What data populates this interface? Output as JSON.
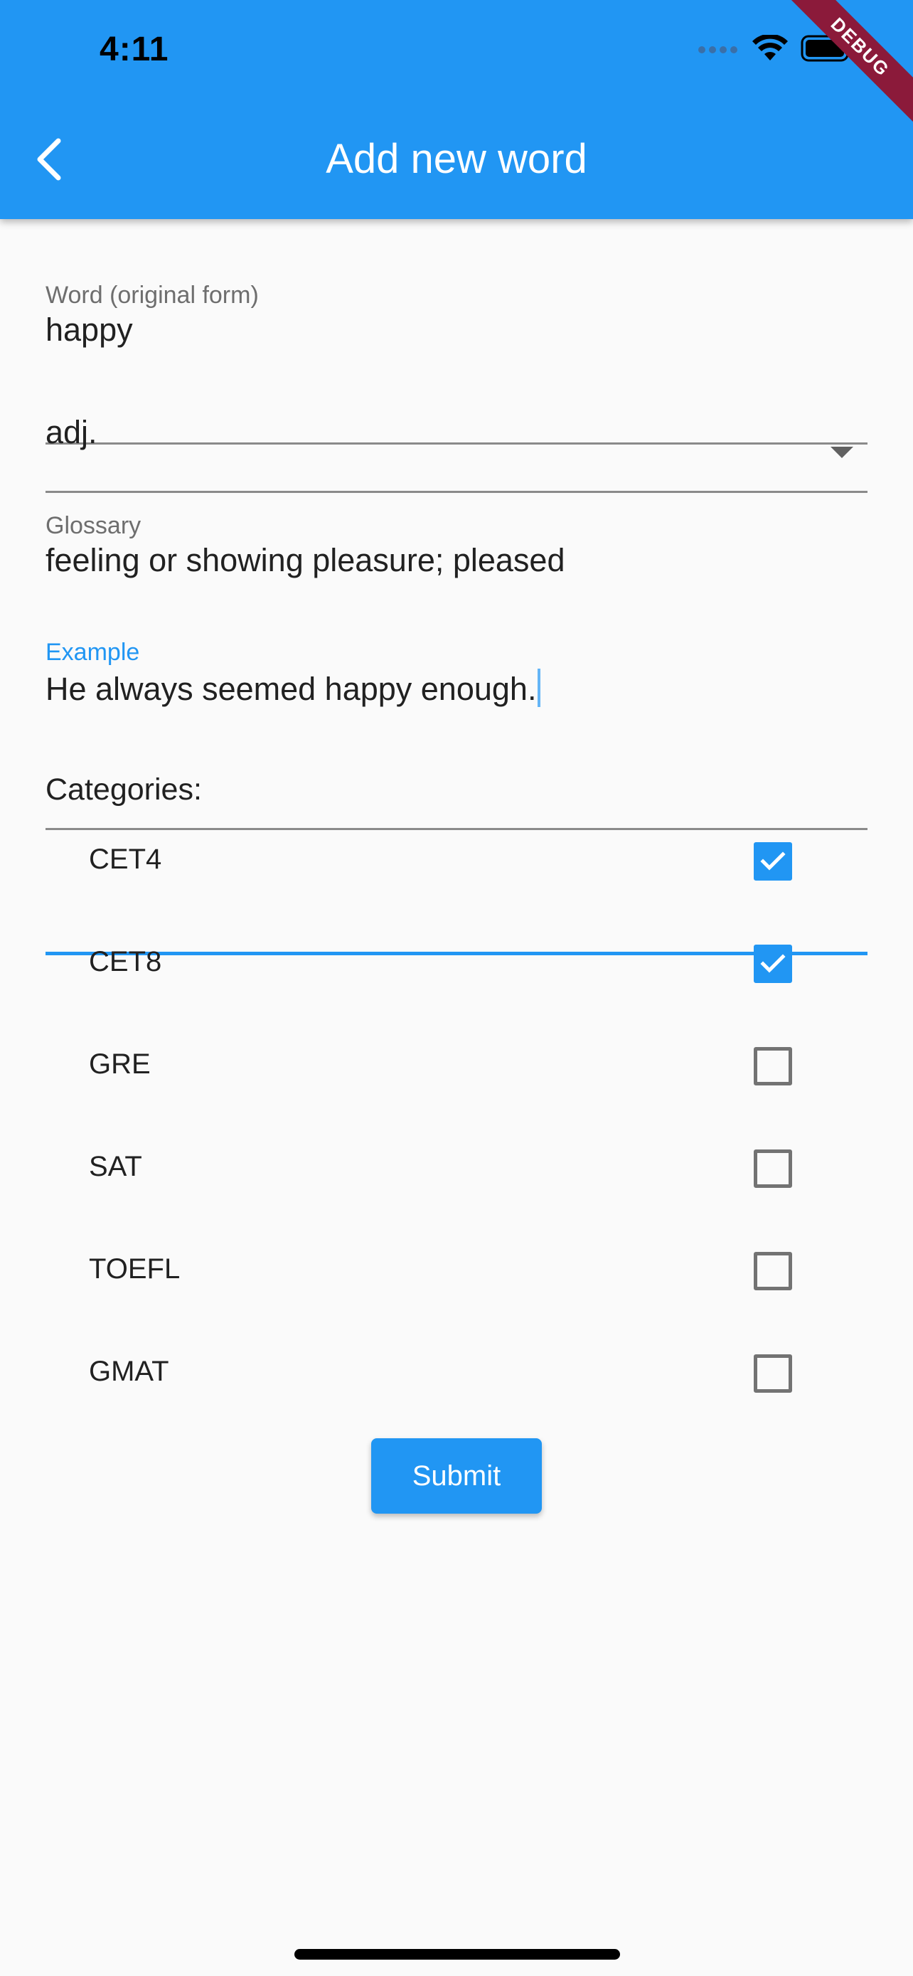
{
  "status_bar": {
    "time": "4:11",
    "icons": [
      "cellular-dots-icon",
      "wifi-icon",
      "battery-icon"
    ]
  },
  "debug_banner": "DEBUG",
  "app_bar": {
    "title": "Add new word",
    "back_icon": "chevron-left-icon",
    "color": "#2196f3"
  },
  "form": {
    "word": {
      "label": "Word (original form)",
      "value": "happy"
    },
    "part_of_speech": {
      "value": "adj.",
      "icon": "dropdown-arrow-icon"
    },
    "glossary": {
      "label": "Glossary",
      "value": "feeling or showing pleasure; pleased"
    },
    "example": {
      "label": "Example",
      "value": "He always seemed happy enough.",
      "focused": true
    }
  },
  "categories": {
    "title": "Categories:",
    "items": [
      {
        "label": "CET4",
        "checked": true
      },
      {
        "label": "CET8",
        "checked": true
      },
      {
        "label": "GRE",
        "checked": false
      },
      {
        "label": "SAT",
        "checked": false
      },
      {
        "label": "TOEFL",
        "checked": false
      },
      {
        "label": "GMAT",
        "checked": false
      }
    ]
  },
  "submit_label": "Submit",
  "colors": {
    "accent": "#2196f3",
    "unchecked_border": "#737373",
    "debug_ribbon": "#8b1a3a"
  }
}
